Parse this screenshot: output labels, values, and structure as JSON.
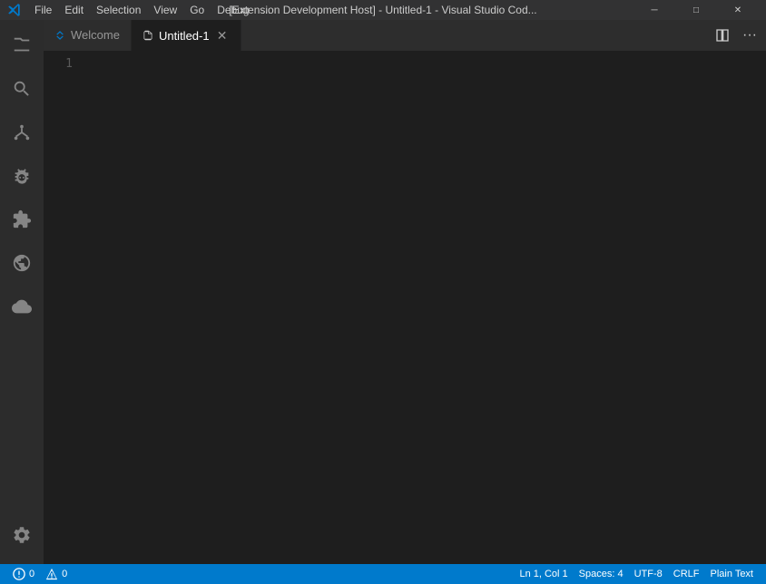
{
  "titlebar": {
    "title": "[Extension Development Host] - Untitled-1 - Visual Studio Cod...",
    "controls": {
      "minimize": "─",
      "maximize": "□",
      "close": "✕"
    },
    "menu": [
      "File",
      "Edit",
      "Selection",
      "View",
      "Go",
      "Debug",
      "..."
    ]
  },
  "tabs": [
    {
      "id": "welcome",
      "label": "Welcome",
      "active": false,
      "closable": false,
      "icon": "vscode-icon"
    },
    {
      "id": "untitled-1",
      "label": "Untitled-1",
      "active": true,
      "closable": true,
      "icon": "file-icon"
    }
  ],
  "editor": {
    "lines": [
      "1"
    ]
  },
  "statusbar": {
    "left": [
      {
        "id": "errors",
        "text": "0",
        "icon": "error-icon"
      },
      {
        "id": "warnings",
        "text": "0",
        "icon": "warning-icon"
      }
    ],
    "right": [
      {
        "id": "cursor",
        "text": "Ln 1, Col 1"
      },
      {
        "id": "spaces",
        "text": "Spaces: 4"
      },
      {
        "id": "encoding",
        "text": "UTF-8"
      },
      {
        "id": "eol",
        "text": "CRLF"
      },
      {
        "id": "language",
        "text": "Plain Text"
      }
    ]
  },
  "activity_bar": {
    "items": [
      {
        "id": "explorer",
        "icon": "files-icon",
        "active": false
      },
      {
        "id": "search",
        "icon": "search-icon",
        "active": false
      },
      {
        "id": "source-control",
        "icon": "source-control-icon",
        "active": false
      },
      {
        "id": "debug",
        "icon": "debug-icon",
        "active": false
      },
      {
        "id": "extensions",
        "icon": "extensions-icon",
        "active": false
      },
      {
        "id": "remote-explorer",
        "icon": "remote-icon",
        "active": false
      },
      {
        "id": "cloud",
        "icon": "cloud-icon",
        "active": false
      }
    ],
    "bottom": [
      {
        "id": "settings",
        "icon": "gear-icon"
      }
    ]
  }
}
